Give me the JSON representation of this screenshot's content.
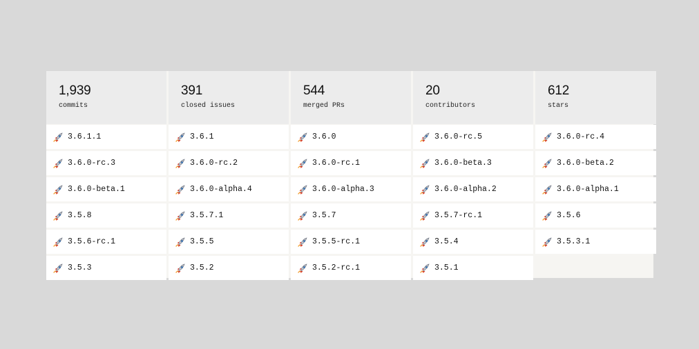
{
  "stats": [
    {
      "value": "1,939",
      "label": "commits"
    },
    {
      "value": "391",
      "label": "closed issues"
    },
    {
      "value": "544",
      "label": "merged PRs"
    },
    {
      "value": "20",
      "label": "contributors"
    },
    {
      "value": "612",
      "label": "stars"
    }
  ],
  "release_icon": "rocket-icon",
  "colors": {
    "page_background": "#d9d9d9",
    "stat_background": "#ececec",
    "release_background": "#ffffff",
    "empty_cell": "#f6f5f2"
  },
  "releases": [
    "3.6.1.1",
    "3.6.1",
    "3.6.0",
    "3.6.0-rc.5",
    "3.6.0-rc.4",
    "3.6.0-rc.3",
    "3.6.0-rc.2",
    "3.6.0-rc.1",
    "3.6.0-beta.3",
    "3.6.0-beta.2",
    "3.6.0-beta.1",
    "3.6.0-alpha.4",
    "3.6.0-alpha.3",
    "3.6.0-alpha.2",
    "3.6.0-alpha.1",
    "3.5.8",
    "3.5.7.1",
    "3.5.7",
    "3.5.7-rc.1",
    "3.5.6",
    "3.5.6-rc.1",
    "3.5.5",
    "3.5.5-rc.1",
    "3.5.4",
    "3.5.3.1",
    "3.5.3",
    "3.5.2",
    "3.5.2-rc.1",
    "3.5.1"
  ]
}
